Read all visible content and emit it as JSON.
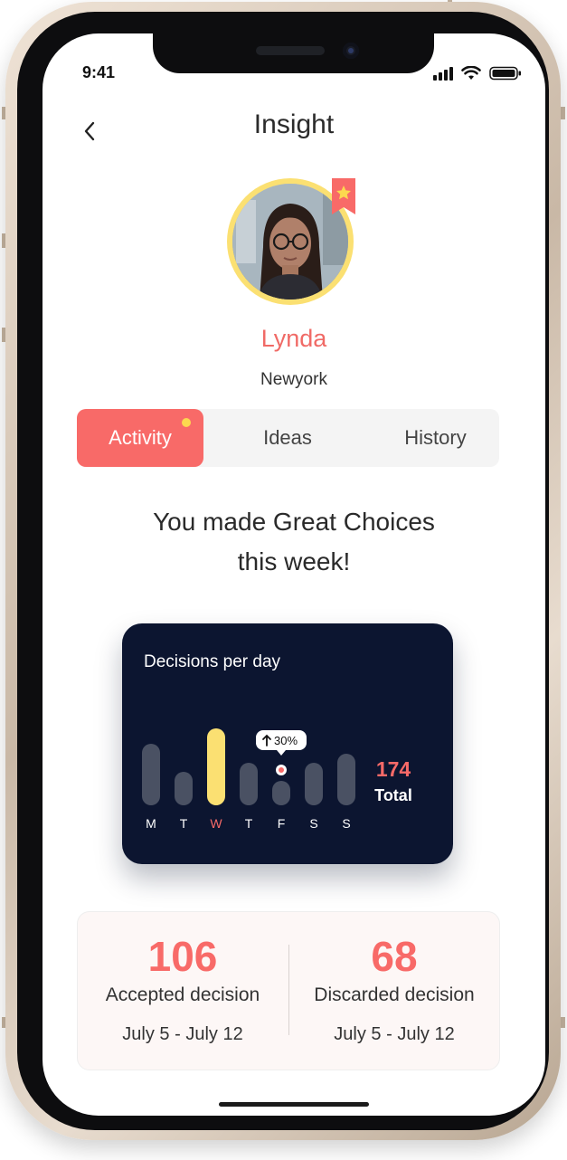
{
  "status_bar": {
    "time": "9:41"
  },
  "header": {
    "title": "Insight"
  },
  "profile": {
    "name": "Lynda",
    "location": "Newyork"
  },
  "tabs": [
    {
      "label": "Activity",
      "active": true,
      "notification": true
    },
    {
      "label": "Ideas",
      "active": false
    },
    {
      "label": "History",
      "active": false
    }
  ],
  "headline": {
    "line1": "You made Great Choices",
    "line2": "this week!"
  },
  "chart_data": {
    "type": "bar",
    "title": "Decisions per day",
    "categories": [
      "M",
      "T",
      "W",
      "T",
      "F",
      "S",
      "S"
    ],
    "values": [
      68,
      37,
      85,
      47,
      27,
      47,
      57
    ],
    "highlight_index": 2,
    "highlight_color": "#fbe072",
    "bar_color": "#4a5163",
    "marker_index": 4,
    "marker_label": "30%",
    "marker_direction": "up",
    "total_value": "174",
    "total_label": "Total",
    "ylim": [
      0,
      100
    ]
  },
  "stats": {
    "accepted": {
      "value": "106",
      "label": "Accepted decision",
      "range": "July 5 - July 12"
    },
    "discarded": {
      "value": "68",
      "label": "Discarded decision",
      "range": "July 5 - July 12"
    }
  },
  "colors": {
    "accent": "#f86a68",
    "highlight": "#fbe072",
    "card_dark": "#0c1530"
  },
  "icons": {
    "back": "chevron-left-icon",
    "bookmark": "star-bookmark-icon",
    "signal": "cellular-signal-icon",
    "wifi": "wifi-icon",
    "battery": "battery-icon"
  }
}
